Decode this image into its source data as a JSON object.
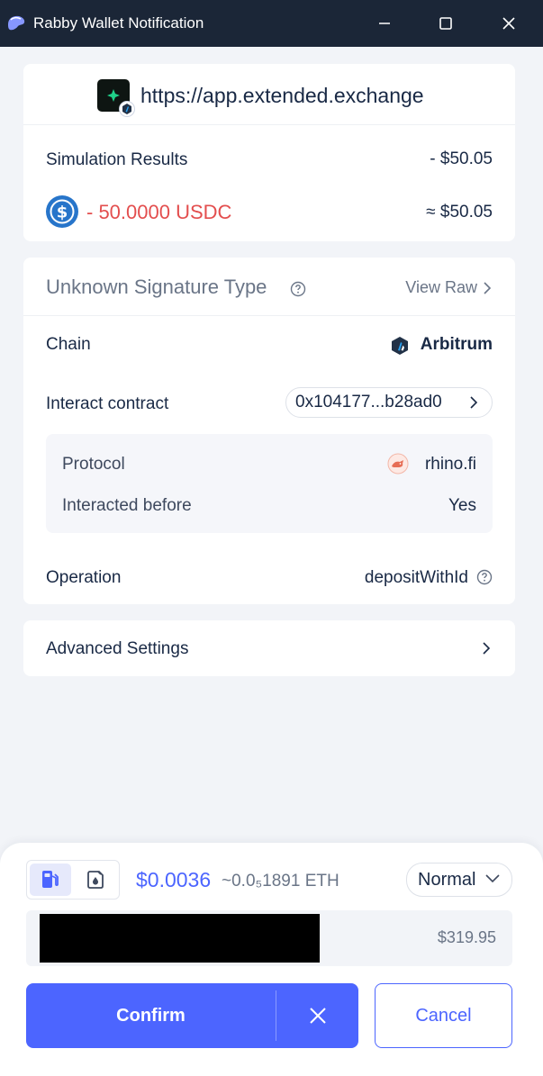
{
  "window": {
    "title": "Rabby Wallet Notification",
    "icon": "rabby-icon",
    "controls": [
      "minimize-icon",
      "maximize-icon",
      "close-icon"
    ]
  },
  "site": {
    "url": "https://app.extended.exchange",
    "logo_icon": "extended-exchange-logo",
    "chain_badge_icon": "arbitrum-icon"
  },
  "simulation": {
    "label": "Simulation Results",
    "total": "- $50.05",
    "token_icon": "usdc-icon",
    "token_change": "- 50.0000 USDC",
    "token_value": "≈ $50.05"
  },
  "signature": {
    "title": "Unknown Signature Type",
    "view_raw": "View Raw",
    "chain_label": "Chain",
    "chain_value": "Arbitrum",
    "contract_label": "Interact contract",
    "contract_value": "0x104177...b28ad0",
    "protocol_label": "Protocol",
    "protocol_value": "rhino.fi",
    "interacted_label": "Interacted before",
    "interacted_value": "Yes",
    "operation_label": "Operation",
    "operation_value": "depositWithId"
  },
  "advanced": {
    "label": "Advanced Settings"
  },
  "gas": {
    "usd": "$0.0036",
    "eth": "~0.0₅1891 ETH",
    "speed": "Normal",
    "options": [
      "gas-pump-icon",
      "gas-account-icon"
    ]
  },
  "account": {
    "balance": "$319.95"
  },
  "actions": {
    "confirm": "Confirm",
    "cancel": "Cancel"
  },
  "colors": {
    "titlebar": "#1b2637",
    "accent": "#4c65ff",
    "negative": "#e34e4e",
    "background": "#f2f4f8"
  }
}
